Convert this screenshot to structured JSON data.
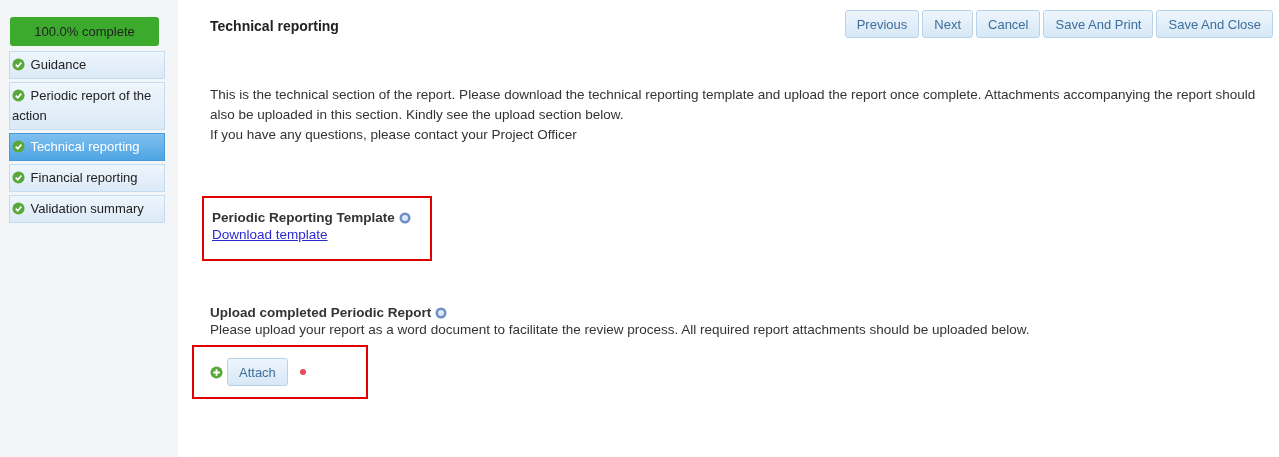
{
  "sidebar": {
    "progress": {
      "label": "100.0% complete",
      "level": 1.0
    },
    "items": [
      {
        "label": "Guidance",
        "done": true,
        "selected": false
      },
      {
        "label": "Periodic report of the action",
        "done": true,
        "selected": false
      },
      {
        "label": "Technical reporting",
        "done": true,
        "selected": true
      },
      {
        "label": "Financial reporting",
        "done": true,
        "selected": false
      },
      {
        "label": "Validation summary",
        "done": true,
        "selected": false
      }
    ]
  },
  "title": "Technical reporting",
  "buttons": [
    "Previous",
    "Next",
    "Cancel",
    "Save And Print",
    "Save And Close"
  ],
  "intro": [
    "This is the technical section of the report. Please download the technical reporting template and upload the report once complete. Attachments accompanying the report should also be uploaded in this section. Kindly see the upload section below.",
    "If you have any questions, please contact your Project Officer"
  ],
  "template_section": {
    "heading": "Periodic Reporting Template",
    "link": "Download template",
    "highlighted": true
  },
  "upload_section": {
    "heading": "Upload completed Periodic Report",
    "description": "Please upload your report as a word document to facilitate the review process. All required report attachments should be uploaded below.",
    "attach_button": "Attach",
    "required": true,
    "highlighted": true
  }
}
